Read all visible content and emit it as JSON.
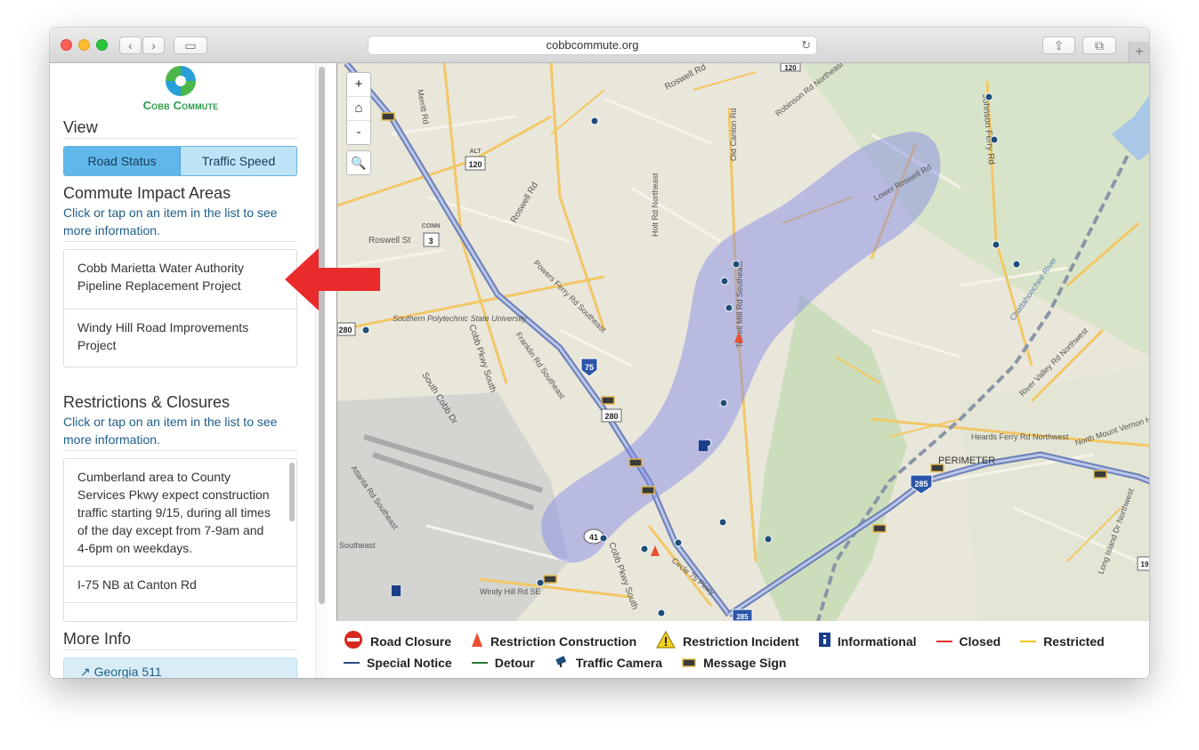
{
  "browser": {
    "url": "cobbcommute.org"
  },
  "logo": {
    "text": "Cobb Commute"
  },
  "view": {
    "title": "View",
    "tabs": [
      {
        "label": "Road Status",
        "active": true
      },
      {
        "label": "Traffic Speed",
        "active": false
      }
    ]
  },
  "impact": {
    "title": "Commute Impact Areas",
    "hint": "Click or tap on an item in the list to see more information.",
    "items": [
      "Cobb Marietta Water Authority Pipeline Replacement Project",
      "Windy Hill Road Improvements Project"
    ]
  },
  "restrictions": {
    "title": "Restrictions & Closures",
    "hint": "Click or tap on an item in the list to see more information.",
    "items": [
      "Cumberland area to County Services Pkwy expect construction traffic starting 9/15, during all times of the day except from 7-9am and 4-6pm on weekdays.",
      "I-75 NB at Canton Rd"
    ]
  },
  "more_info": {
    "title": "More Info",
    "button": "Georgia 511"
  },
  "map": {
    "zoom_in": "+",
    "zoom_out": "-",
    "labels": {
      "roswell_rd_ne": "Roswell Rd",
      "roswell_rd_w": "Roswell Rd",
      "roswell_st": "Roswell St",
      "lower_roswell": "Lower Roswell Rd",
      "old_canton": "Old Canton Rd",
      "robinson": "Robinson Rd Northeast",
      "hunt_rd": "Holt Rd Northeast",
      "powers_ferry": "Powers Ferry Rd Southeast",
      "franklin": "Franklin Rd Southeast",
      "south_cobb": "South Cobb Dr",
      "cobb_pkwy": "Cobb Pkwy South",
      "cobb_pkwy2": "Cobb Pkwy South",
      "southern_poly": "Southern Polytechnic State University",
      "terrell_mill": "Terrell Mill Rd Southeast",
      "atlanta_rd": "Atlanta Rd Southeast",
      "windy_hill": "Windy Hill Rd SE",
      "circle75": "Circle 75 Pkwy",
      "heards_ferry": "Heards Ferry Rd Northwest",
      "north_mount": "North Mount Vernon Hwy",
      "perimeter": "PERIMETER",
      "river_valley": "River Valley Rd Northwest",
      "chattahoochee": "Chattahoochee River",
      "johnson_ferry": "Johnson Ferry Rd",
      "long_island": "Long Island Dr Northwest",
      "southeast": "Southeast",
      "mert_rd": "Merritt Rd"
    },
    "shields": {
      "i75": "75",
      "us41": "41",
      "i285": "285",
      "us120": "120",
      "conn3": "3",
      "alt120": "120",
      "r280": "280",
      "r280w": "280",
      "top120": "120",
      "gray19": "19",
      "i285b": "285"
    },
    "shield_tags": {
      "alt": "ALT",
      "conn": "CONN"
    }
  },
  "legend": {
    "row1": [
      {
        "label": "Road Closure",
        "icon": "road-closure-icon"
      },
      {
        "label": "Restriction Construction",
        "icon": "construction-cone-icon"
      },
      {
        "label": "Restriction Incident",
        "icon": "warning-triangle-icon"
      },
      {
        "label": "Informational",
        "icon": "info-icon"
      },
      {
        "label": "Closed",
        "color": "#d9342b"
      },
      {
        "label": "Restricted",
        "color": "#f0c419"
      }
    ],
    "row2": [
      {
        "label": "Special Notice",
        "color": "#2f4a8a"
      },
      {
        "label": "Detour",
        "color": "#2f7a3a"
      },
      {
        "label": "Traffic Camera",
        "icon": "traffic-camera-icon"
      },
      {
        "label": "Message Sign",
        "icon": "message-sign-icon"
      }
    ]
  }
}
